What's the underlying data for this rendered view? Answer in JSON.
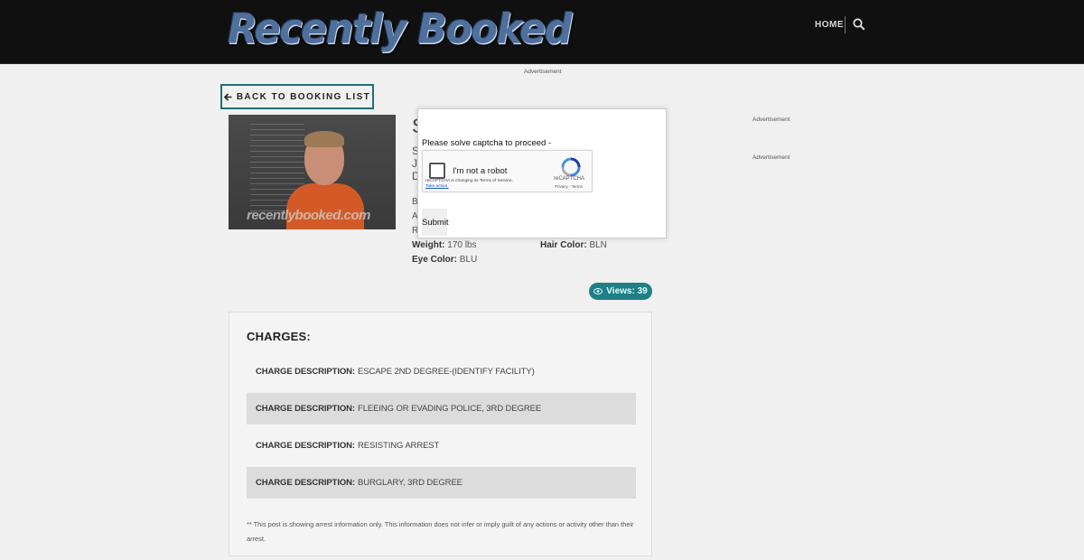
{
  "header": {
    "logo_text": "Recently Booked",
    "nav_home": "HOME",
    "search_icon": "search-icon"
  },
  "ads": {
    "top": "Advertisement",
    "side_1": "Advertisement",
    "side_2": "Advertisement"
  },
  "back_button": {
    "icon": "arrow-left-icon",
    "label": "BACK TO BOOKING LIST"
  },
  "mugshot": {
    "watermark": "recentlybooked.com"
  },
  "profile": {
    "name_initial": "S",
    "line_1": "S",
    "line_2": "J",
    "line_3": "D",
    "attr_b_partial": "B",
    "attr_a_partial": "A",
    "attr_r_partial": "R",
    "weight_label": "Weight:",
    "weight_value": "170 lbs",
    "hair_label": "Hair Color:",
    "hair_value": "BLN",
    "eye_label": "Eye Color:",
    "eye_value": "BLU"
  },
  "views": {
    "icon": "eye-icon",
    "label": "Views: 39"
  },
  "charges": {
    "title": "CHARGES:",
    "items": [
      {
        "label": "CHARGE DESCRIPTION:",
        "value": "ESCAPE 2ND DEGREE-(IDENTIFY FACILITY)"
      },
      {
        "label": "CHARGE DESCRIPTION:",
        "value": "FLEEING OR EVADING POLICE, 3RD DEGREE"
      },
      {
        "label": "CHARGE DESCRIPTION:",
        "value": "RESISTING ARREST"
      },
      {
        "label": "CHARGE DESCRIPTION:",
        "value": "BURGLARY, 3RD DEGREE"
      }
    ],
    "disclaimer": "** This post is showing arrest information only. This information does not infer or imply guilt of any actions or activity other than their arrest."
  },
  "captcha_modal": {
    "prompt": "Please solve captcha to proceed -",
    "checkbox_label": "I'm not a robot",
    "brand": "reCAPTCHA",
    "privacy": "Privacy - Terms",
    "note": "reCAPTCHA is changing its Terms of Service.",
    "note_link": "Take action.",
    "submit_label": "Submit"
  },
  "colors": {
    "accent": "#1f7f86",
    "header_bg": "#101010",
    "page_bg": "#f0f0f0"
  }
}
